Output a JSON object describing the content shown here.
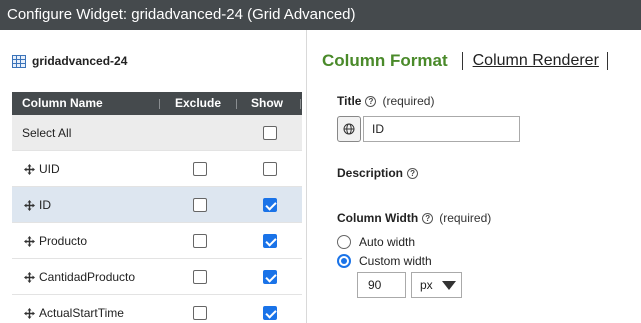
{
  "window": {
    "title": "Configure Widget: gridadvanced-24 (Grid Advanced)"
  },
  "widget": {
    "name": "gridadvanced-24",
    "icon": "grid-icon"
  },
  "table": {
    "headers": {
      "name": "Column Name",
      "exclude": "Exclude",
      "show": "Show"
    },
    "select_all": {
      "label": "Select All",
      "show": false
    },
    "rows": [
      {
        "label": "UID",
        "exclude": false,
        "show": false,
        "selected": false
      },
      {
        "label": "ID",
        "exclude": false,
        "show": true,
        "selected": true
      },
      {
        "label": "Producto",
        "exclude": false,
        "show": true,
        "selected": false
      },
      {
        "label": "CantidadProducto",
        "exclude": false,
        "show": true,
        "selected": false
      },
      {
        "label": "ActualStartTime",
        "exclude": false,
        "show": true,
        "selected": false
      }
    ]
  },
  "tabs": {
    "active": "Column Format",
    "other": "Column Renderer"
  },
  "form": {
    "title_label": "Title",
    "required_text": "(required)",
    "title_value": "ID",
    "description_label": "Description",
    "column_width_label": "Column Width",
    "auto_width_label": "Auto width",
    "custom_width_label": "Custom width",
    "width_mode": "custom",
    "width_value": "90",
    "width_unit": "px"
  },
  "colors": {
    "titlebar": "#454a4d",
    "accent": "#1a73e8",
    "active_tab": "#4a8a2a",
    "selected_row": "#dde6f0"
  }
}
